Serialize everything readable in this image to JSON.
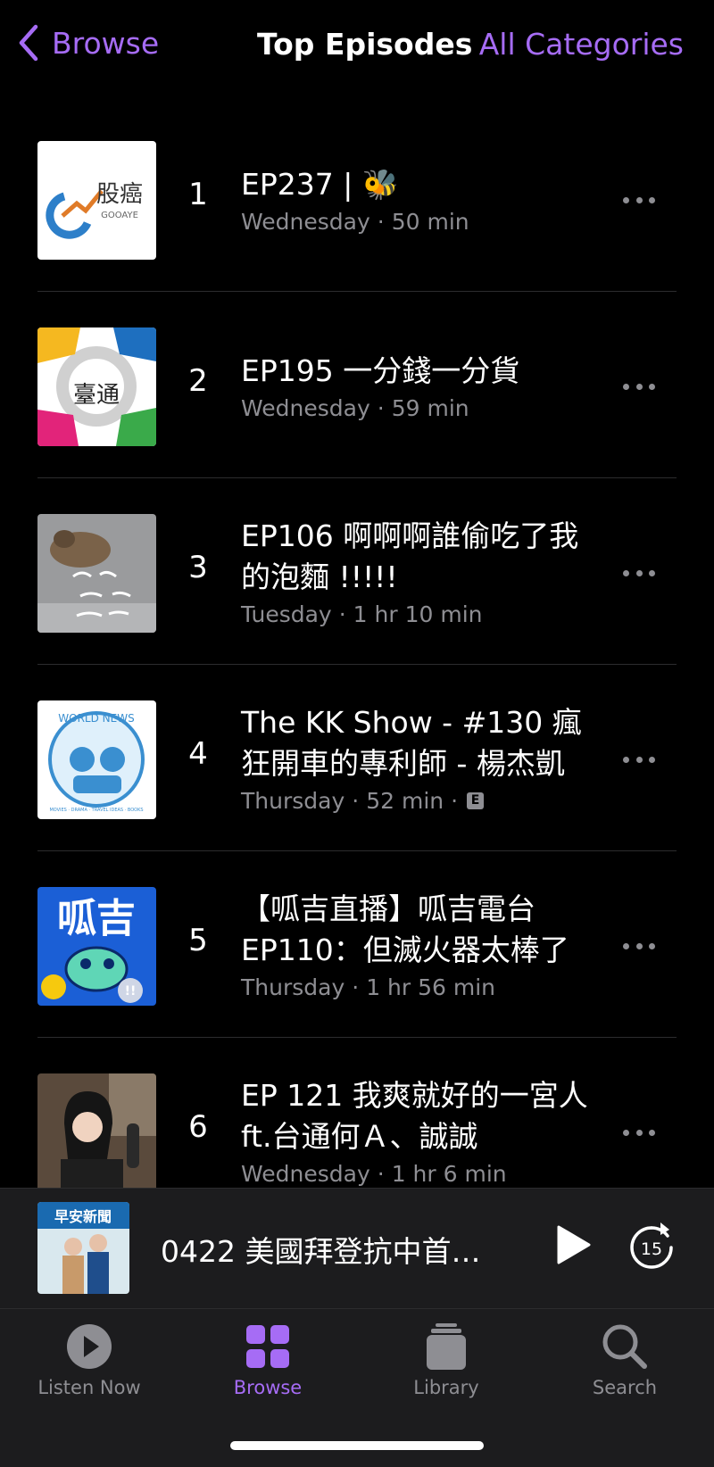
{
  "nav": {
    "back_label": "Browse",
    "title": "Top Episodes",
    "right_label": "All Categories"
  },
  "colors": {
    "accent": "#a66cf5",
    "secondary_text": "#8e8e93",
    "background": "#000000"
  },
  "episodes": [
    {
      "rank": "1",
      "title": "EP237 | 🐝",
      "day": "Wednesday",
      "duration": "50 min",
      "explicit": "",
      "art_text": "股癌",
      "art_subtext": "GOOAYE"
    },
    {
      "rank": "2",
      "title": "EP195 一分錢一分貨",
      "day": "Wednesday",
      "duration": "59 min",
      "explicit": "",
      "art_text": "臺通",
      "art_subtext": ""
    },
    {
      "rank": "3",
      "title": "EP106 啊啊啊誰偷吃了我的泡麵 !!!!!",
      "day": "Tuesday",
      "duration": "1 hr 10 min",
      "explicit": "",
      "art_text": "",
      "art_subtext": ""
    },
    {
      "rank": "4",
      "title": "The KK Show - #130 瘋狂開車的專利師 - 楊杰凱",
      "day": "Thursday",
      "duration": "52 min",
      "explicit": "E",
      "art_text": "WORLD NEWS",
      "art_subtext": "MOVIES · DRAMA · TRAVEL IDEAS · BOOKS"
    },
    {
      "rank": "5",
      "title": "【呱吉直播】呱吉電台EP110：但滅火器太棒了",
      "day": "Thursday",
      "duration": "1 hr 56 min",
      "explicit": "",
      "art_text": "呱吉",
      "art_subtext": "!!"
    },
    {
      "rank": "6",
      "title": "EP 121 我爽就好的一宮人 ft.台通何Ａ、誠誠",
      "day": "Wednesday",
      "duration": "1 hr 6 min",
      "explicit": "",
      "art_text": "",
      "art_subtext": ""
    }
  ],
  "meta_separator": "·",
  "mini_player": {
    "title": "0422 美國拜登抗中首…",
    "art_text": "早安新聞",
    "skip_seconds": "15"
  },
  "tabs": [
    {
      "label": "Listen Now",
      "icon": "play-circle-icon",
      "active": false
    },
    {
      "label": "Browse",
      "icon": "grid-icon",
      "active": true
    },
    {
      "label": "Library",
      "icon": "library-stack-icon",
      "active": false
    },
    {
      "label": "Search",
      "icon": "search-icon",
      "active": false
    }
  ]
}
